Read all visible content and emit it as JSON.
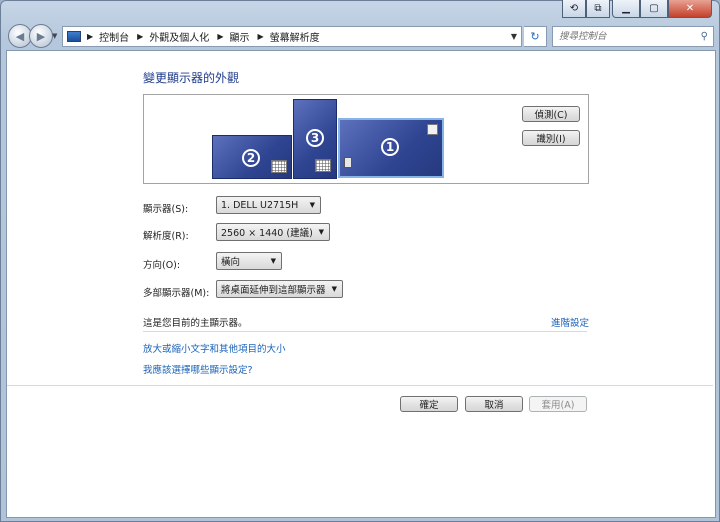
{
  "window": {
    "caption_buttons": [
      "minimize-icon",
      "maximize-icon",
      "close-icon"
    ]
  },
  "nav": {
    "breadcrumbs": [
      "控制台",
      "外觀及個人化",
      "顯示",
      "螢幕解析度"
    ],
    "search_placeholder": "搜尋控制台"
  },
  "page": {
    "title": "變更顯示器的外觀",
    "detect_label": "偵測(C)",
    "identify_label": "識別(I)",
    "monitors": [
      "1",
      "2",
      "3"
    ],
    "display_label": "顯示器(S):",
    "display_value": "1. DELL U2715H",
    "resolution_label": "解析度(R):",
    "resolution_value": "2560 × 1440 (建議)",
    "orientation_label": "方向(O):",
    "orientation_value": "橫向",
    "multi_label": "多部顯示器(M):",
    "multi_value": "將桌面延伸到這部顯示器",
    "info_text": "這是您目前的主顯示器。",
    "advanced_link": "進階設定",
    "link_text_size": "放大或縮小文字和其他項目的大小",
    "link_which": "我應該選擇哪些顯示設定?"
  },
  "footer": {
    "ok_label": "確定",
    "cancel_label": "取消",
    "apply_label": "套用(A)"
  }
}
